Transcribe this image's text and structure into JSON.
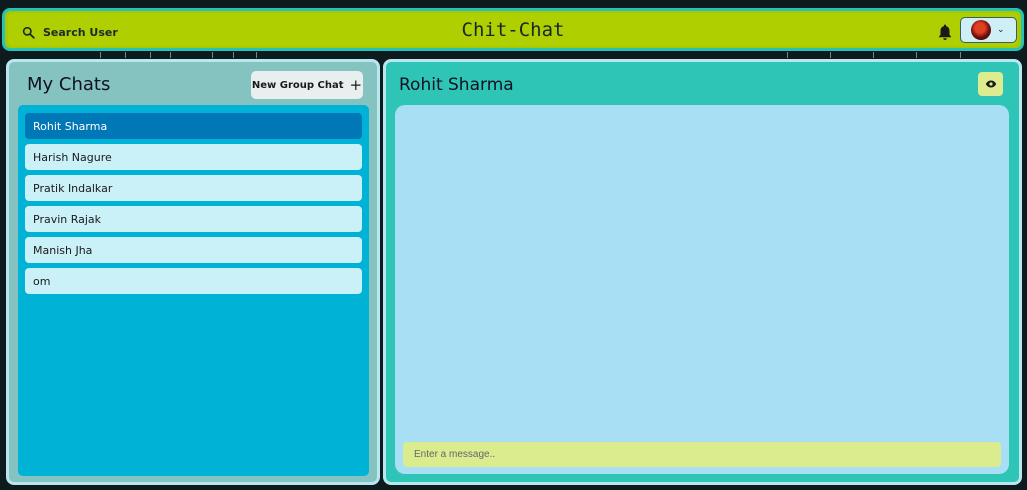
{
  "header": {
    "search_label": "Search User",
    "app_title": "Chit-Chat",
    "icons": {
      "search": "search-icon",
      "bell": "bell-icon",
      "chevron": "chevron-down-icon"
    }
  },
  "sidebar": {
    "title": "My Chats",
    "new_group_label": "New Group Chat",
    "new_group_icon": "+",
    "chats": [
      {
        "name": "Rohit Sharma",
        "active": true
      },
      {
        "name": "Harish Nagure",
        "active": false
      },
      {
        "name": "Pratik Indalkar",
        "active": false
      },
      {
        "name": "Pravin Rajak",
        "active": false
      },
      {
        "name": "Manish Jha",
        "active": false
      },
      {
        "name": "om",
        "active": false
      }
    ]
  },
  "chat": {
    "title": "Rohit Sharma",
    "message_placeholder": "Enter a message.."
  },
  "colors": {
    "header_bg": "#b0cf00",
    "chat_list_bg": "#00b2d6",
    "active_chat": "#0077b6",
    "chat_item": "#caf0f8",
    "right_panel": "#2ec4b6",
    "messages_bg": "#a8dff5",
    "input_bg": "#dbec8f"
  }
}
